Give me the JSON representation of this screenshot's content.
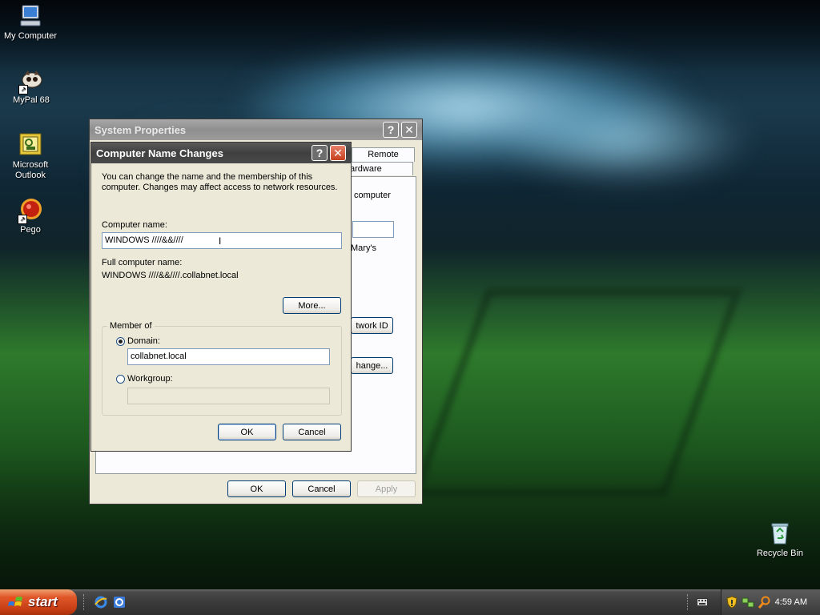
{
  "desktop": {
    "icons": [
      {
        "label": "My Computer",
        "icon": "my-computer-icon"
      },
      {
        "label": "MyPal 68",
        "icon": "mypal-icon"
      },
      {
        "label": "Microsoft\nOutlook",
        "label_line1": "Microsoft",
        "label_line2": "Outlook",
        "icon": "outlook-icon"
      },
      {
        "label": "Pego",
        "icon": "pego-icon"
      },
      {
        "label": "Recycle Bin",
        "icon": "recycle-bin-icon"
      }
    ]
  },
  "system_properties": {
    "title": "System Properties",
    "help_glyph": "?",
    "close_glyph": "✕",
    "tabs": {
      "remote": "Remote",
      "hardware": "ardware"
    },
    "partial_text": {
      "computer": "computer",
      "marys": "Mary's",
      "network_id": "twork ID",
      "change": "hange..."
    },
    "ok_label": "OK",
    "cancel_label": "Cancel",
    "apply_label": "Apply"
  },
  "computer_name_changes": {
    "title": "Computer Name Changes",
    "help_glyph": "?",
    "close_glyph": "✕",
    "description_line1": "You can change the name and the membership of this",
    "description_line2": "computer. Changes may affect access to network resources.",
    "computer_name_label": "Computer name:",
    "computer_name_value": "WINDOWS ////&&////",
    "full_name_label": "Full computer name:",
    "full_name_value": "WINDOWS ////&&////.collabnet.local",
    "more_label": "More...",
    "member_of_label": "Member of",
    "domain_label": "Domain:",
    "domain_value": "collabnet.local",
    "workgroup_label": "Workgroup:",
    "workgroup_value": "",
    "ok_label": "OK",
    "cancel_label": "Cancel",
    "selected_membership": "Domain"
  },
  "taskbar": {
    "start_label": "start",
    "clock": "4:59 AM",
    "quick_launch": [
      "internet-explorer-icon",
      "browser-icon"
    ],
    "tray_icons": [
      "security-shield-icon",
      "network-icon",
      "search-icon"
    ]
  },
  "colors": {
    "dialog_face": "#ece9d8",
    "active_titlebar": "#3f3f3f",
    "inactive_titlebar": "#8e8e8e",
    "start_button": "#c43c12"
  }
}
